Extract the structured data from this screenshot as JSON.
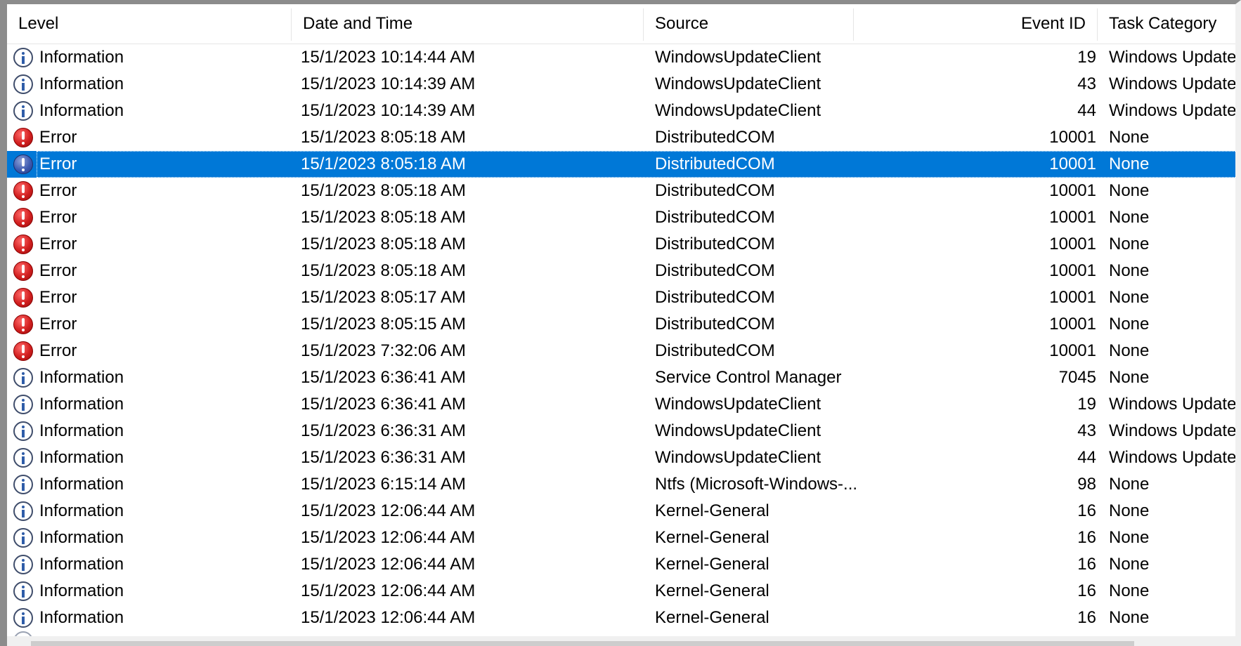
{
  "columns": [
    {
      "key": "level",
      "label": "Level"
    },
    {
      "key": "date",
      "label": "Date and Time"
    },
    {
      "key": "source",
      "label": "Source"
    },
    {
      "key": "event_id",
      "label": "Event ID"
    },
    {
      "key": "task",
      "label": "Task Category"
    }
  ],
  "icons": {
    "information": "information-icon",
    "error": "error-icon"
  },
  "colors": {
    "selection": "#0078d7",
    "error": "#d21f1f",
    "info_outline": "#3f4d6b"
  },
  "selected_row_index": 4,
  "rows": [
    {
      "type": "information",
      "level": "Information",
      "date": "15/1/2023 10:14:44 AM",
      "source": "WindowsUpdateClient",
      "event_id": "19",
      "task": "Windows Update"
    },
    {
      "type": "information",
      "level": "Information",
      "date": "15/1/2023 10:14:39 AM",
      "source": "WindowsUpdateClient",
      "event_id": "43",
      "task": "Windows Update"
    },
    {
      "type": "information",
      "level": "Information",
      "date": "15/1/2023 10:14:39 AM",
      "source": "WindowsUpdateClient",
      "event_id": "44",
      "task": "Windows Update"
    },
    {
      "type": "error",
      "level": "Error",
      "date": "15/1/2023 8:05:18 AM",
      "source": "DistributedCOM",
      "event_id": "10001",
      "task": "None"
    },
    {
      "type": "error",
      "level": "Error",
      "date": "15/1/2023 8:05:18 AM",
      "source": "DistributedCOM",
      "event_id": "10001",
      "task": "None"
    },
    {
      "type": "error",
      "level": "Error",
      "date": "15/1/2023 8:05:18 AM",
      "source": "DistributedCOM",
      "event_id": "10001",
      "task": "None"
    },
    {
      "type": "error",
      "level": "Error",
      "date": "15/1/2023 8:05:18 AM",
      "source": "DistributedCOM",
      "event_id": "10001",
      "task": "None"
    },
    {
      "type": "error",
      "level": "Error",
      "date": "15/1/2023 8:05:18 AM",
      "source": "DistributedCOM",
      "event_id": "10001",
      "task": "None"
    },
    {
      "type": "error",
      "level": "Error",
      "date": "15/1/2023 8:05:18 AM",
      "source": "DistributedCOM",
      "event_id": "10001",
      "task": "None"
    },
    {
      "type": "error",
      "level": "Error",
      "date": "15/1/2023 8:05:17 AM",
      "source": "DistributedCOM",
      "event_id": "10001",
      "task": "None"
    },
    {
      "type": "error",
      "level": "Error",
      "date": "15/1/2023 8:05:15 AM",
      "source": "DistributedCOM",
      "event_id": "10001",
      "task": "None"
    },
    {
      "type": "error",
      "level": "Error",
      "date": "15/1/2023 7:32:06 AM",
      "source": "DistributedCOM",
      "event_id": "10001",
      "task": "None"
    },
    {
      "type": "information",
      "level": "Information",
      "date": "15/1/2023 6:36:41 AM",
      "source": "Service Control Manager",
      "event_id": "7045",
      "task": "None"
    },
    {
      "type": "information",
      "level": "Information",
      "date": "15/1/2023 6:36:41 AM",
      "source": "WindowsUpdateClient",
      "event_id": "19",
      "task": "Windows Update"
    },
    {
      "type": "information",
      "level": "Information",
      "date": "15/1/2023 6:36:31 AM",
      "source": "WindowsUpdateClient",
      "event_id": "43",
      "task": "Windows Update"
    },
    {
      "type": "information",
      "level": "Information",
      "date": "15/1/2023 6:36:31 AM",
      "source": "WindowsUpdateClient",
      "event_id": "44",
      "task": "Windows Update"
    },
    {
      "type": "information",
      "level": "Information",
      "date": "15/1/2023 6:15:14 AM",
      "source": "Ntfs (Microsoft-Windows-...",
      "event_id": "98",
      "task": "None"
    },
    {
      "type": "information",
      "level": "Information",
      "date": "15/1/2023 12:06:44 AM",
      "source": "Kernel-General",
      "event_id": "16",
      "task": "None"
    },
    {
      "type": "information",
      "level": "Information",
      "date": "15/1/2023 12:06:44 AM",
      "source": "Kernel-General",
      "event_id": "16",
      "task": "None"
    },
    {
      "type": "information",
      "level": "Information",
      "date": "15/1/2023 12:06:44 AM",
      "source": "Kernel-General",
      "event_id": "16",
      "task": "None"
    },
    {
      "type": "information",
      "level": "Information",
      "date": "15/1/2023 12:06:44 AM",
      "source": "Kernel-General",
      "event_id": "16",
      "task": "None"
    },
    {
      "type": "information",
      "level": "Information",
      "date": "15/1/2023 12:06:44 AM",
      "source": "Kernel-General",
      "event_id": "16",
      "task": "None"
    }
  ]
}
